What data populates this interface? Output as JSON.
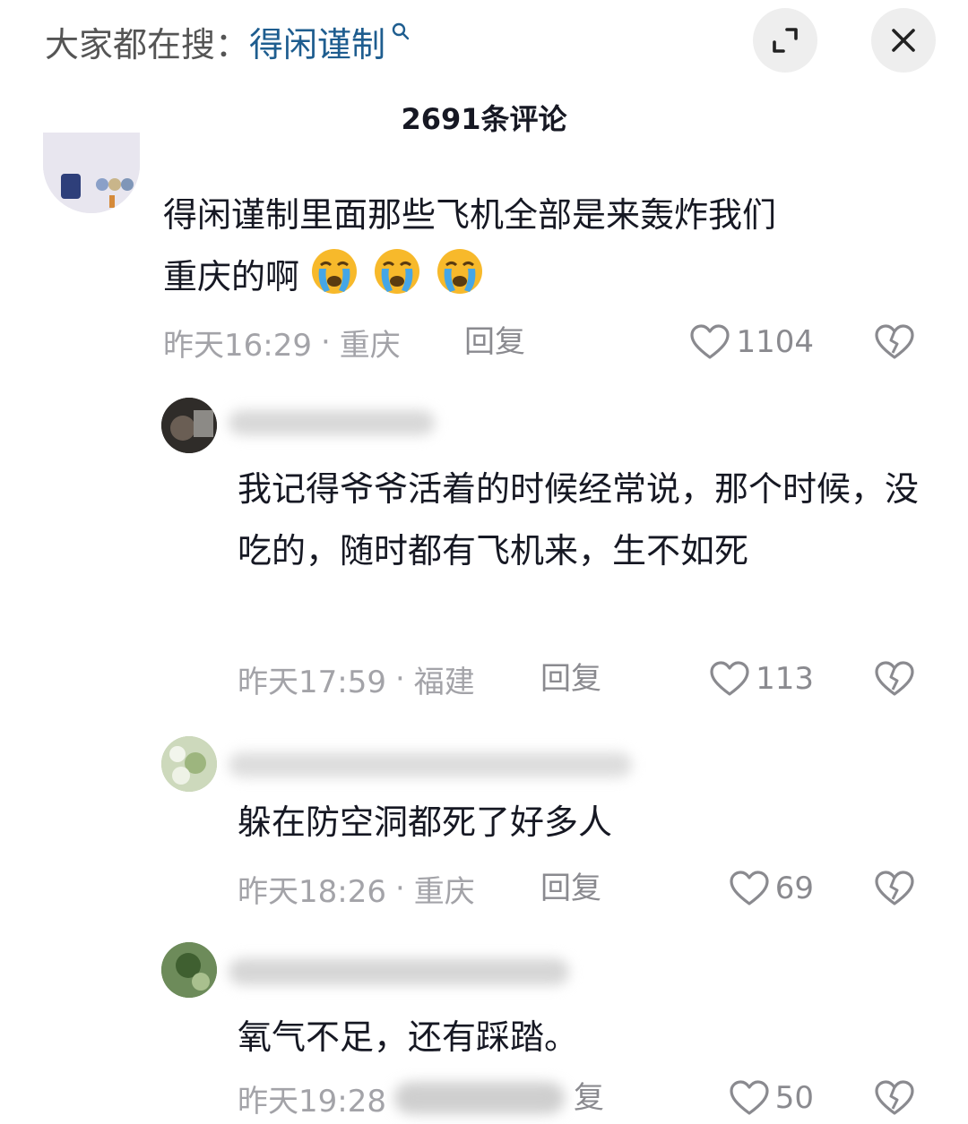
{
  "search_hint": {
    "prefix": "大家都在搜：",
    "keyword": "得闲谨制"
  },
  "header": {
    "comment_count": "2691条评论"
  },
  "comments": [
    {
      "text_line1": "得闲谨制里面那些飞机全部是来轰炸我们",
      "text_line2": "重庆的啊",
      "emoji": "loudly-crying-face",
      "time": "昨天16:29",
      "location": "重庆",
      "reply": "回复",
      "likes": "1104"
    },
    {
      "text": "我记得爷爷活着的时候经常说，那个时候，没吃的，随时都有飞机来，生不如死",
      "time": "昨天17:59",
      "location": "福建",
      "reply": "回复",
      "likes": "113"
    },
    {
      "text": "躲在防空洞都死了好多人",
      "time": "昨天18:26",
      "location": "重庆",
      "reply": "回复",
      "likes": "69"
    },
    {
      "text": "氧气不足，还有踩踏。",
      "time": "昨天19:28",
      "reply_suffix": "复",
      "likes": "50"
    }
  ],
  "colors": {
    "keyword": "#1e5d8f",
    "meta": "#a3a3a8",
    "text": "#161823"
  }
}
